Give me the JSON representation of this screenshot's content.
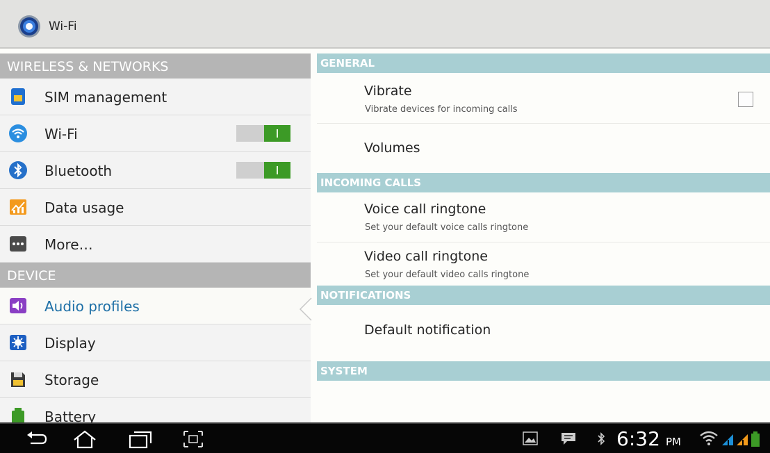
{
  "action_bar": {
    "title": "Wi-Fi",
    "icon": "settings-gear-icon"
  },
  "left_pane": {
    "wireless_header": "WIRELESS & NETWORKS",
    "device_header": "DEVICE",
    "items": [
      {
        "label": "SIM management",
        "icon": "sim-card-icon"
      },
      {
        "label": "Wi-Fi",
        "icon": "wifi-icon",
        "toggle": "on"
      },
      {
        "label": "Bluetooth",
        "icon": "bluetooth-icon",
        "toggle": "on"
      },
      {
        "label": "Data usage",
        "icon": "data-usage-icon"
      },
      {
        "label": "More…",
        "icon": "more-dots-icon"
      },
      {
        "label": "Audio profiles",
        "icon": "speaker-icon",
        "selected": true
      },
      {
        "label": "Display",
        "icon": "brightness-icon"
      },
      {
        "label": "Storage",
        "icon": "storage-icon"
      },
      {
        "label": "Battery",
        "icon": "battery-icon"
      }
    ]
  },
  "right_pane": {
    "general_header": "GENERAL",
    "vibrate": {
      "title": "Vibrate",
      "subtitle": "Vibrate devices for incoming calls",
      "checked": false
    },
    "volumes": {
      "title": "Volumes"
    },
    "incoming_header": "INCOMING CALLS",
    "voice_ringtone": {
      "title": "Voice call ringtone",
      "subtitle": "Set your default voice calls ringtone"
    },
    "video_ringtone": {
      "title": "Video call ringtone",
      "subtitle": "Set your default video calls ringtone"
    },
    "notifications_header": "NOTIFICATIONS",
    "default_notification": {
      "title": "Default notification"
    },
    "system_header": "SYSTEM"
  },
  "status_bar": {
    "time": "6:32",
    "ampm": "PM"
  },
  "colors": {
    "toggle_on": "#3c9a26",
    "section_header_left": "#b5b5b5",
    "section_header_right": "#a8cfd3",
    "selected_text": "#1d6fa6"
  }
}
